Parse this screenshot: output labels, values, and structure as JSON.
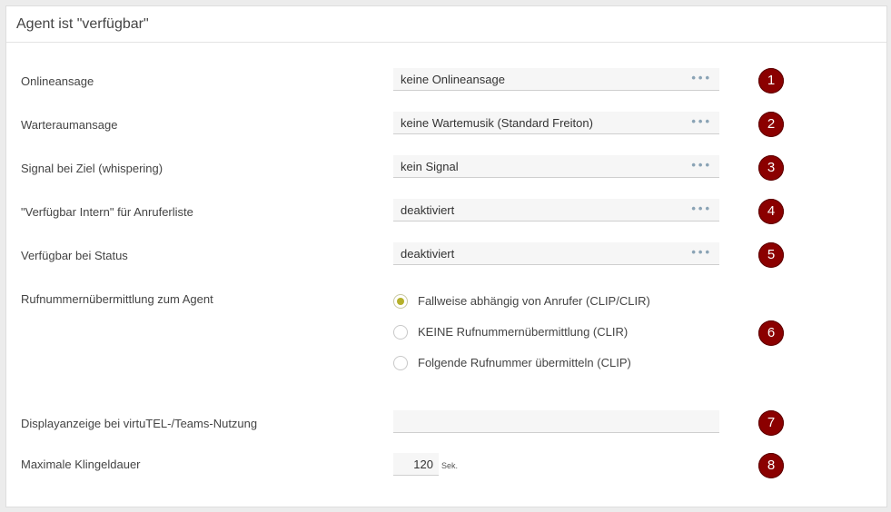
{
  "panel": {
    "title": "Agent ist \"verfügbar\""
  },
  "rows": [
    {
      "label": "Onlineansage",
      "value": "keine Onlineansage",
      "badge": "1"
    },
    {
      "label": "Warteraumansage",
      "value": "keine Wartemusik (Standard Freiton)",
      "badge": "2"
    },
    {
      "label": "Signal bei Ziel (whispering)",
      "value": "kein Signal",
      "badge": "3"
    },
    {
      "label": "\"Verfügbar Intern\" für Anruferliste",
      "value": "deaktiviert",
      "badge": "4"
    },
    {
      "label": "Verfügbar bei Status",
      "value": "deaktiviert",
      "badge": "5"
    }
  ],
  "dots_label": "•••",
  "clip": {
    "label": "Rufnummernübermittlung zum Agent",
    "badge": "6",
    "options": [
      {
        "label": "Fallweise abhängig von Anrufer (CLIP/CLIR)",
        "checked": true
      },
      {
        "label": "KEINE Rufnummernübermittlung (CLIR)",
        "checked": false
      },
      {
        "label": "Folgende Rufnummer übermitteln (CLIP)",
        "checked": false
      }
    ]
  },
  "display": {
    "label": "Displayanzeige bei virtuTEL-/Teams-Nutzung",
    "value": "",
    "badge": "7"
  },
  "ring": {
    "label": "Maximale Klingeldauer",
    "value": "120",
    "unit": "Sek.",
    "badge": "8"
  },
  "colors": {
    "badge": "#8b0000",
    "radio_checked": "#b5b02a",
    "dots": "#8aa3b5"
  }
}
